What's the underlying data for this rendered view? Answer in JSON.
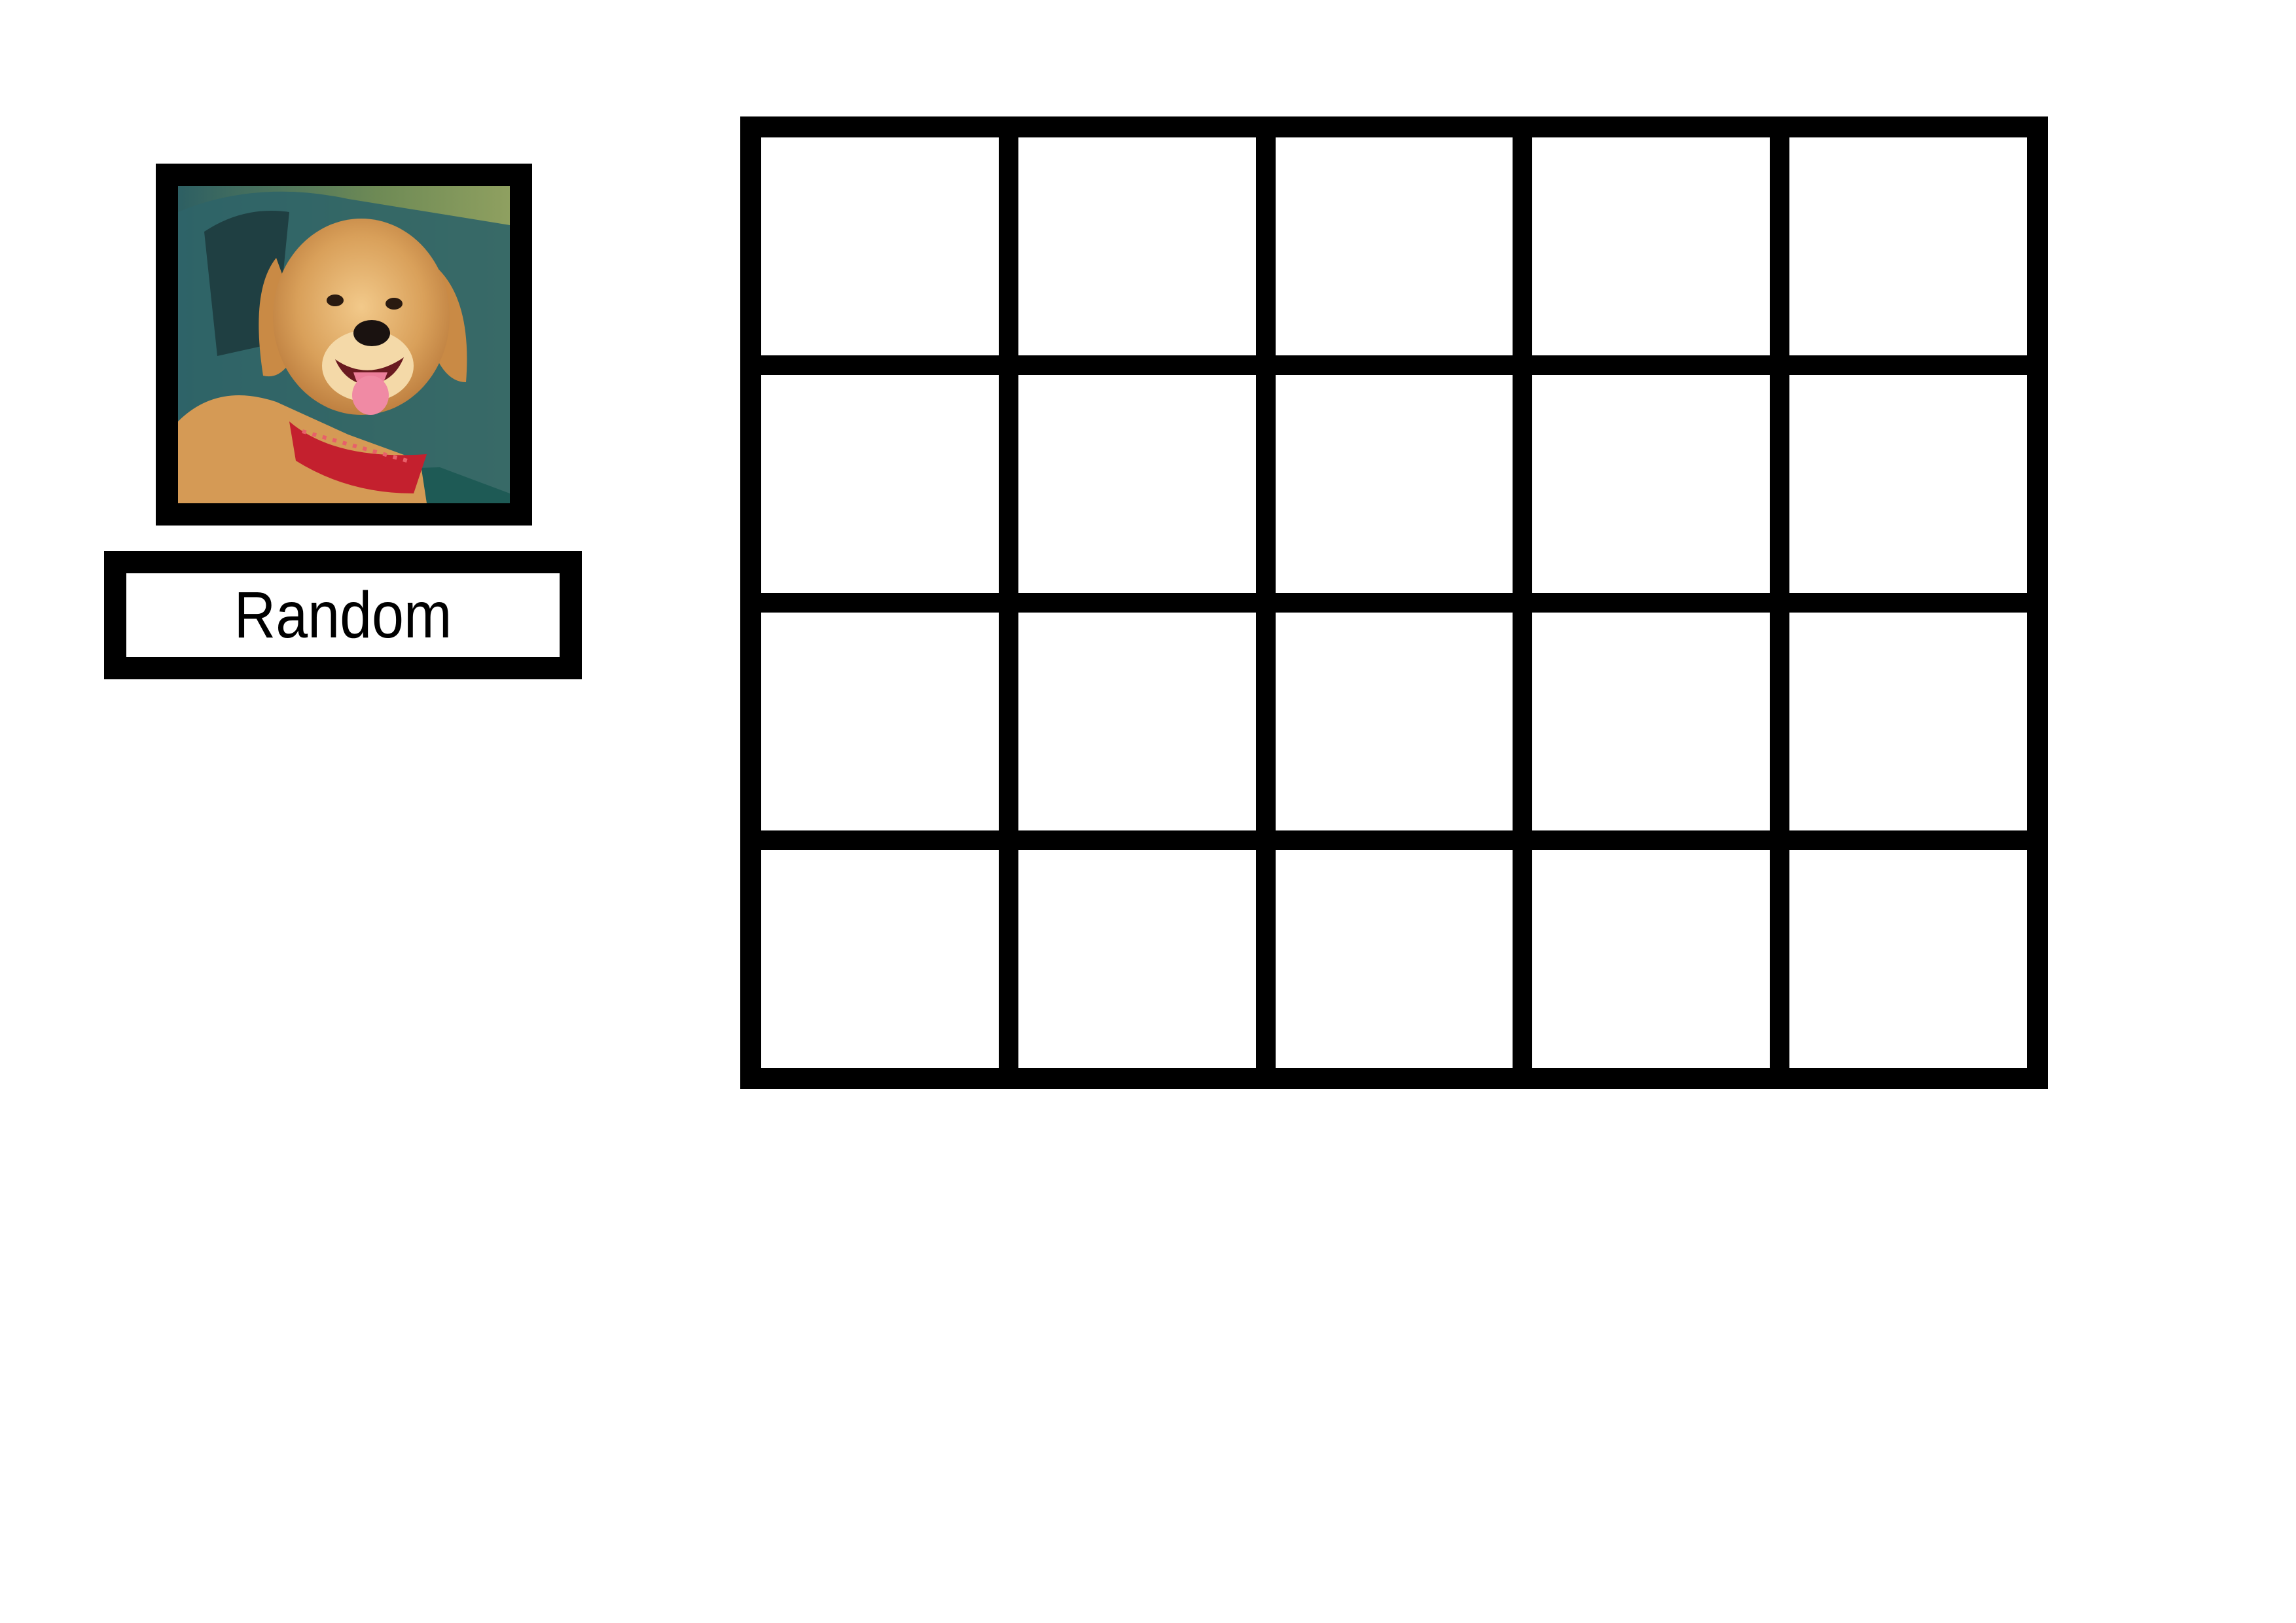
{
  "card": {
    "image_icon": "golden-retriever-dog-photo",
    "label": "Random"
  },
  "board": {
    "rows": 4,
    "columns": 5,
    "cells": [
      [
        "",
        "",
        "",
        "",
        ""
      ],
      [
        "",
        "",
        "",
        "",
        ""
      ],
      [
        "",
        "",
        "",
        "",
        ""
      ],
      [
        "",
        "",
        "",
        "",
        ""
      ]
    ]
  },
  "colors": {
    "border": "#000000",
    "background": "#ffffff"
  }
}
